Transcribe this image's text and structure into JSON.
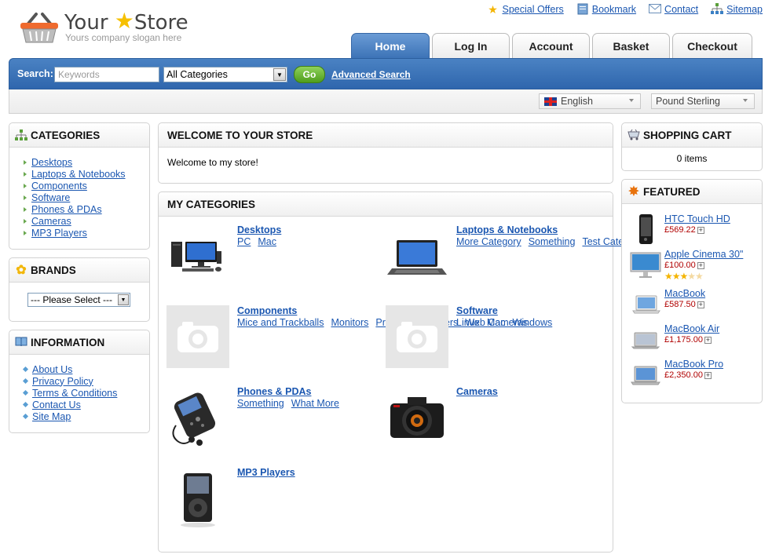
{
  "header": {
    "store_word1": "Your",
    "store_word2": "Store",
    "slogan": "Yours company slogan here",
    "top_links": [
      {
        "label": "Special Offers",
        "icon": "star-icon"
      },
      {
        "label": "Bookmark",
        "icon": "bookmark-icon"
      },
      {
        "label": "Contact",
        "icon": "mail-icon"
      },
      {
        "label": "Sitemap",
        "icon": "sitemap-icon"
      }
    ],
    "tabs": [
      "Home",
      "Log In",
      "Account",
      "Basket",
      "Checkout"
    ],
    "active_tab": "Home"
  },
  "search": {
    "label": "Search:",
    "placeholder": "Keywords",
    "category": "All Categories",
    "go_label": "Go",
    "advanced_label": "Advanced Search"
  },
  "settings": {
    "language": "English",
    "currency": "Pound Sterling"
  },
  "sidebar_left": {
    "categories_title": "CATEGORIES",
    "categories": [
      "Desktops",
      "Laptops & Notebooks",
      "Components",
      "Software",
      "Phones & PDAs",
      "Cameras",
      "MP3 Players"
    ],
    "brands_title": "BRANDS",
    "brands_select": "--- Please Select ---",
    "information_title": "INFORMATION",
    "information": [
      "About Us",
      "Privacy Policy",
      "Terms & Conditions",
      "Contact Us",
      "Site Map"
    ]
  },
  "welcome": {
    "title": "WELCOME TO YOUR STORE",
    "text": "Welcome to my store!"
  },
  "my_categories": {
    "title": "MY CATEGORIES",
    "items": [
      {
        "name": "Desktops",
        "subs": [
          "PC",
          "Mac"
        ]
      },
      {
        "name": "Laptops & Notebooks",
        "subs": [
          "More Category",
          "Something",
          "Test Category"
        ]
      },
      {
        "name": "Components",
        "subs": [
          "Mice and Trackballs",
          "Monitors",
          "Printers",
          "Scanners",
          "Web Cameras"
        ]
      },
      {
        "name": "Software",
        "subs": [
          "Linux",
          "Mac",
          "Windows"
        ]
      },
      {
        "name": "Phones & PDAs",
        "subs": [
          "Something",
          "What More"
        ]
      },
      {
        "name": "Cameras",
        "subs": []
      },
      {
        "name": "MP3 Players",
        "subs": []
      }
    ]
  },
  "cart": {
    "title": "SHOPPING CART",
    "summary": "0 items"
  },
  "featured": {
    "title": "FEATURED",
    "items": [
      {
        "name": "HTC Touch HD",
        "price": "£569.22"
      },
      {
        "name": "Apple Cinema 30\"",
        "price": "£100.00",
        "rating": 3
      },
      {
        "name": "MacBook",
        "price": "£587.50"
      },
      {
        "name": "MacBook Air",
        "price": "£1,175.00"
      },
      {
        "name": "MacBook Pro",
        "price": "£2,350.00"
      }
    ]
  }
}
